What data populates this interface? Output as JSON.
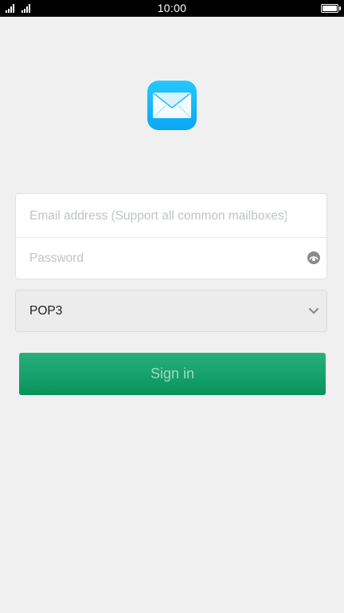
{
  "status_bar": {
    "time": "10:00",
    "signal_icon_1": "cellular-signal-icon",
    "signal_icon_2": "cellular-signal-icon",
    "battery_icon": "battery-icon"
  },
  "app": {
    "logo_icon": "mail-envelope-icon",
    "logo_color": "#17b8fb"
  },
  "login_form": {
    "email": {
      "value": "",
      "placeholder": "Email address (Support all common mailboxes)"
    },
    "password": {
      "value": "",
      "placeholder": "Password",
      "toggle_icon": "eye-icon"
    },
    "protocol": {
      "selected": "POP3",
      "icon": "chevron-down-icon"
    },
    "sign_in_label": "Sign in",
    "sign_in_color": "#0d9963"
  }
}
